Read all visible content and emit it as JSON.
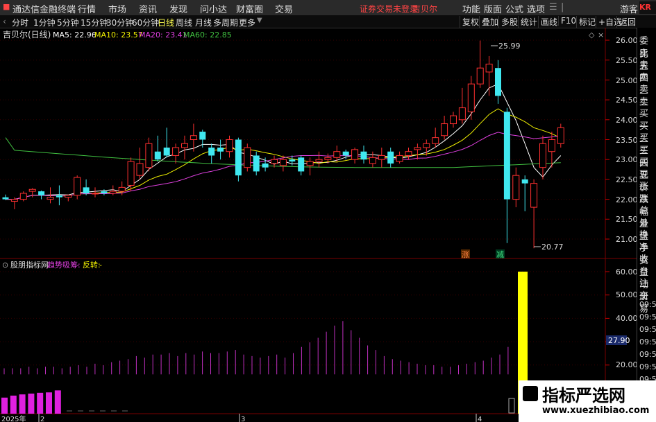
{
  "topbar": {
    "app_title": "通达信金融终端",
    "menu": [
      "行情",
      "市场",
      "资讯",
      "发现",
      "问小达",
      "财富圈",
      "交易"
    ],
    "notice": "证券交易未登录",
    "stock": "吉贝尔",
    "right_menu": [
      "功能",
      "版面",
      "公式",
      "选项"
    ],
    "user": "游客"
  },
  "toolbar": {
    "periods": [
      "分时",
      "1分钟",
      "5分钟",
      "15分钟",
      "30分钟",
      "60分钟",
      "日线",
      "周线",
      "月线",
      "多周期",
      "更多"
    ],
    "active_period": "日线",
    "actions": [
      "复权",
      "叠加",
      "多股",
      "统计",
      "画线",
      "F10",
      "标记",
      "+自选",
      "返回"
    ]
  },
  "main_chart": {
    "title": "吉贝尔(日线)",
    "ma": [
      {
        "label": "MA5: 22.96",
        "color": "#ffffff"
      },
      {
        "label": "MA10: 23.57",
        "color": "#f0f000"
      },
      {
        "label": "MA20: 23.41",
        "color": "#e040e0"
      },
      {
        "label": "MA60: 22.85",
        "color": "#40c040"
      }
    ],
    "high_label": "25.99",
    "low_label": "20.77",
    "markers": [
      "涨",
      "减"
    ],
    "y_ticks": [
      "26.00",
      "25.50",
      "25.00",
      "24.50",
      "24.00",
      "23.50",
      "23.00",
      "22.50",
      "22.00",
      "21.50",
      "21.00"
    ]
  },
  "sub_chart": {
    "title": "股朋指标网",
    "line1": "趋势吸筹:",
    "line1_value": "-",
    "line2": "反转:",
    "line2_value": "-",
    "y_ticks": [
      "60.00",
      "50.00",
      "40.00",
      "30.00",
      "20.00"
    ],
    "current_value": "27.90"
  },
  "x_axis": [
    "2025年",
    "2",
    "3",
    "4"
  ],
  "sidebar": [
    "委比",
    "卖五",
    "卖四",
    "卖三",
    "卖二",
    "卖一",
    "买一",
    "买二",
    "买三",
    "买四",
    "买五",
    "现价",
    "涨跌",
    "涨幅",
    "总量",
    "外盘",
    "换手",
    "净资",
    "收益",
    "自动",
    "注册",
    "交易"
  ],
  "sidebar_times": [
    "09:52",
    "09:53",
    "09:53",
    "09:53",
    "09:53",
    "09:53",
    "09:53"
  ],
  "watermark": {
    "title": "指标严选网",
    "url": "www.xuezhibiao.com"
  },
  "colors": {
    "up": "#ff3030",
    "down": "#40e8f0",
    "ma5": "#ffffff",
    "ma10": "#f0f000",
    "ma20": "#e040e0",
    "ma60": "#40c040",
    "bar": "#c030c0",
    "highlight": "#ffff00"
  }
}
